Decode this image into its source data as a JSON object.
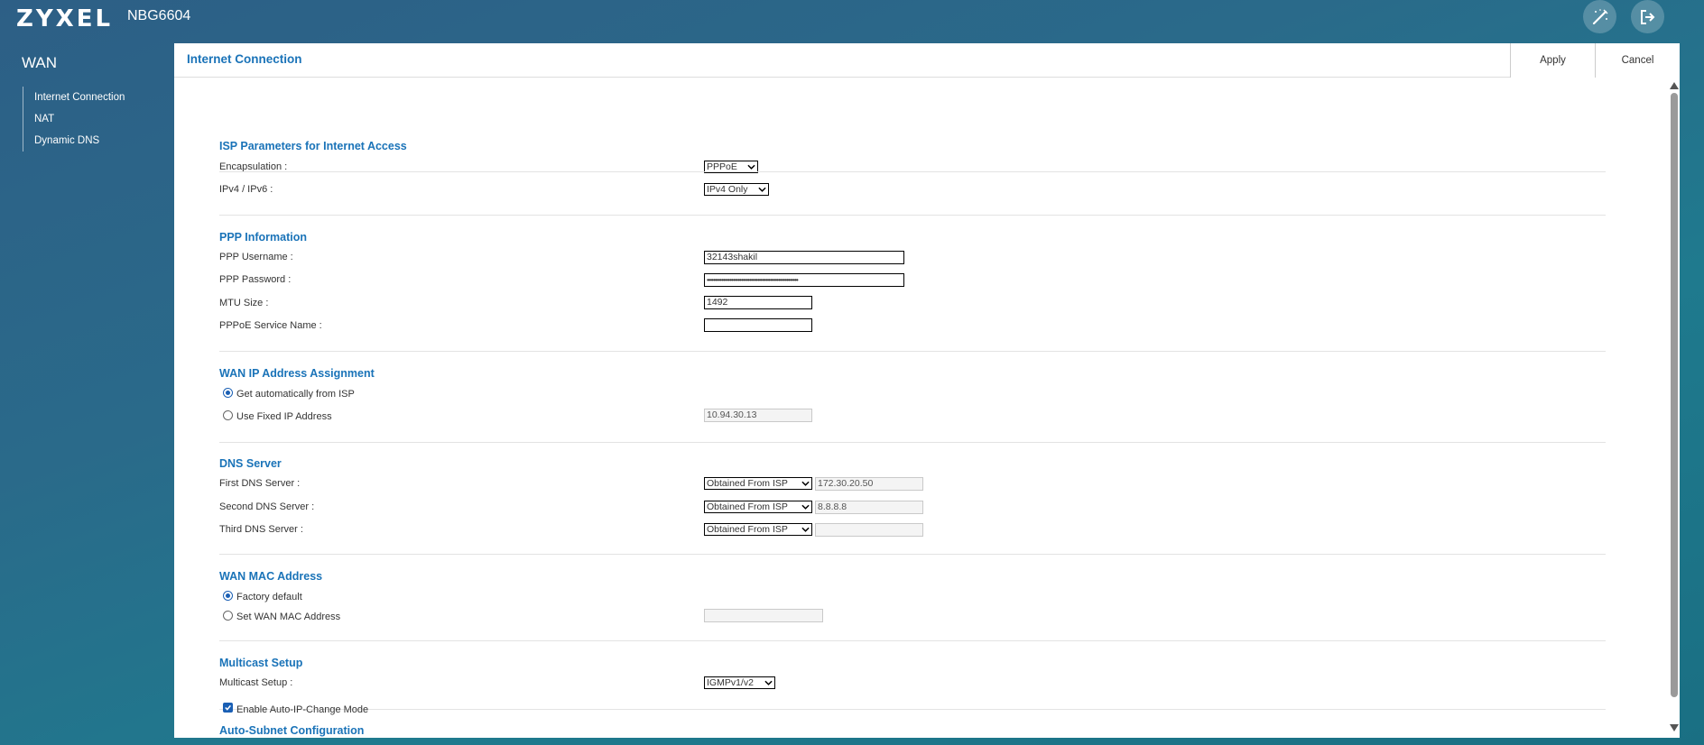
{
  "header": {
    "logo": "ZYXEL",
    "model": "NBG6604",
    "icons": [
      "wizard-icon",
      "logout-icon"
    ]
  },
  "sidebar": {
    "title": "WAN",
    "items": [
      {
        "label": "Internet Connection",
        "active": true
      },
      {
        "label": "NAT",
        "active": false
      },
      {
        "label": "Dynamic DNS",
        "active": false
      }
    ]
  },
  "panel": {
    "title": "Internet Connection",
    "apply_label": "Apply",
    "cancel_label": "Cancel"
  },
  "isp": {
    "title": "ISP Parameters for Internet Access",
    "encapsulation_label": "Encapsulation :",
    "encapsulation_value": "PPPoE",
    "ipversion_label": "IPv4 / IPv6 :",
    "ipversion_value": "IPv4 Only"
  },
  "ppp": {
    "title": "PPP Information",
    "username_label": "PPP Username :",
    "username_value": "32143shakil",
    "password_label": "PPP Password :",
    "password_value": "••••••••••••••••••••••••••••••••••••••••••••••••••••••••",
    "mtu_label": "MTU Size :",
    "mtu_value": "1492",
    "service_label": "PPPoE Service Name :",
    "service_value": ""
  },
  "wanip": {
    "title": "WAN IP Address Assignment",
    "auto_label": "Get automatically from ISP",
    "auto_selected": true,
    "fixed_label": "Use Fixed IP Address",
    "fixed_ip_value": "10.94.30.13"
  },
  "dns": {
    "title": "DNS Server",
    "servers": [
      {
        "label": "First DNS Server :",
        "mode": "Obtained From ISP",
        "value": "172.30.20.50"
      },
      {
        "label": "Second DNS Server :",
        "mode": "Obtained From ISP",
        "value": "8.8.8.8"
      },
      {
        "label": "Third DNS Server :",
        "mode": "Obtained From ISP",
        "value": ""
      }
    ]
  },
  "mac": {
    "title": "WAN MAC Address",
    "factory_label": "Factory default",
    "factory_selected": true,
    "set_label": "Set WAN MAC Address",
    "set_value": ""
  },
  "multicast": {
    "title": "Multicast Setup",
    "label": "Multicast Setup :",
    "value": "IGMPv1/v2"
  },
  "autosubnet": {
    "title": "Auto-Subnet Configuration",
    "enable_label": "Enable Auto-IP-Change Mode",
    "enabled": true
  },
  "colors": {
    "accent": "#1a73b8",
    "background": "#2a6a8a"
  }
}
